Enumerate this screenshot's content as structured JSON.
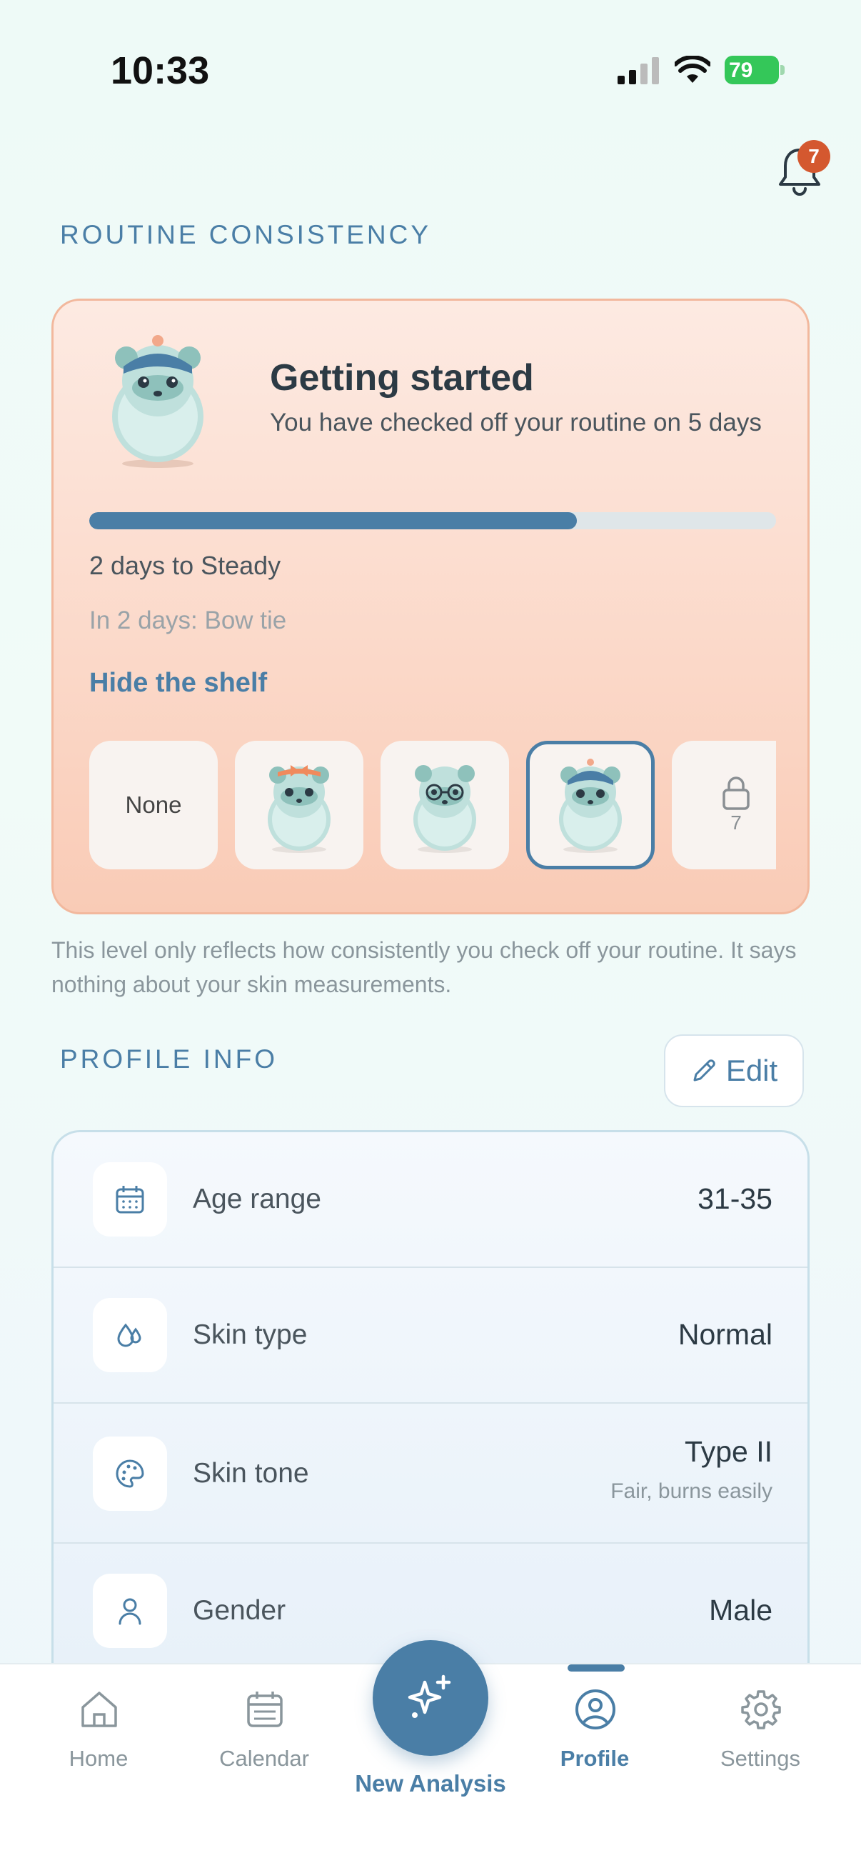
{
  "status_bar": {
    "time": "10:33",
    "battery": "79"
  },
  "notifications": {
    "count": "7",
    "icon": "bell-icon"
  },
  "routine": {
    "section_title": "ROUTINE CONSISTENCY",
    "level_title": "Getting started",
    "subtitle": "You have checked off your routine on 5 days",
    "progress_fraction": 0.71,
    "days_to_next": "2 days to Steady",
    "next_reward": "In 2 days: Bow tie",
    "hide_shelf": "Hide the shelf",
    "shelf": {
      "none_label": "None",
      "items": [
        "mascot-bow",
        "mascot-glasses",
        "mascot-beanie"
      ],
      "locked_day": "7"
    },
    "disclaimer": "This level only reflects how consistently you check off your routine. It says nothing about your skin measurements."
  },
  "profile": {
    "section_title": "PROFILE INFO",
    "edit_label": "Edit",
    "rows": [
      {
        "label": "Age range",
        "value": "31-35",
        "icon": "calendar-icon"
      },
      {
        "label": "Skin type",
        "value": "Normal",
        "icon": "droplets-icon"
      },
      {
        "label": "Skin tone",
        "value": "Type II",
        "sub": "Fair, burns easily",
        "icon": "palette-icon"
      },
      {
        "label": "Gender",
        "value": "Male",
        "icon": "user-icon"
      }
    ]
  },
  "tabbar": {
    "home": "Home",
    "calendar": "Calendar",
    "new_analysis": "New Analysis",
    "profile": "Profile",
    "settings": "Settings",
    "active": "profile"
  },
  "colors": {
    "accent": "#4a7ea6",
    "badge": "#d4582f",
    "card_border": "#f2b89d"
  }
}
